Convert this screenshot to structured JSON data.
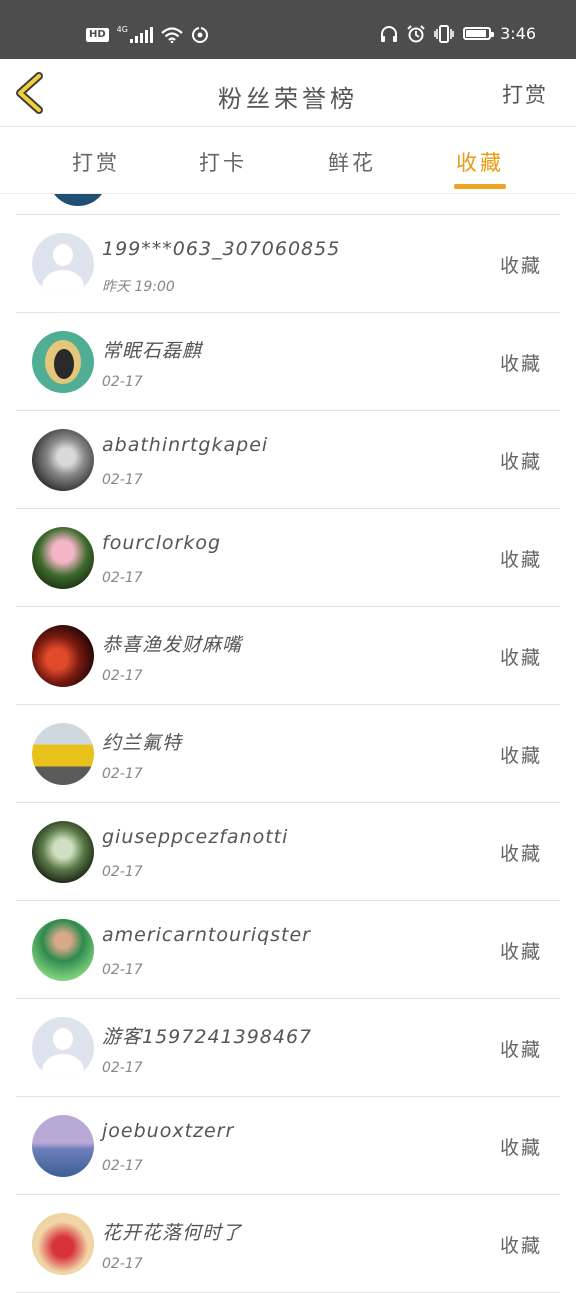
{
  "status_bar": {
    "hd": "HD",
    "network": "4G",
    "time": "3:46",
    "icons": [
      "hd-icon",
      "signal-icon",
      "wifi-icon",
      "hotspot-icon",
      "headphones-icon",
      "alarm-icon",
      "vibrate-icon",
      "battery-icon"
    ]
  },
  "header": {
    "title": "粉丝荣誉榜",
    "action": "打赏",
    "back_icon": "chevron-left-icon",
    "accent_color": "#f0a321"
  },
  "tabs": [
    {
      "label": "打赏",
      "active": false
    },
    {
      "label": "打卡",
      "active": false
    },
    {
      "label": "鲜花",
      "active": false
    },
    {
      "label": "收藏",
      "active": true
    }
  ],
  "fans": [
    {
      "name": "199***063_307060855",
      "time": "昨天 19:00",
      "action": "收藏"
    },
    {
      "name": "常眠石磊麒",
      "time": "02-17",
      "action": "收藏"
    },
    {
      "name": "abathinrtgkapei",
      "time": "02-17",
      "action": "收藏"
    },
    {
      "name": "fourclorkog",
      "time": "02-17",
      "action": "收藏"
    },
    {
      "name": "恭喜渔发财麻嘴",
      "time": "02-17",
      "action": "收藏"
    },
    {
      "name": "约兰氟特",
      "time": "02-17",
      "action": "收藏"
    },
    {
      "name": "giuseppcezfanotti",
      "time": "02-17",
      "action": "收藏"
    },
    {
      "name": "americarntouriqster",
      "time": "02-17",
      "action": "收藏"
    },
    {
      "name": "游客1597241398467",
      "time": "02-17",
      "action": "收藏"
    },
    {
      "name": "joebuoxtzerr",
      "time": "02-17",
      "action": "收藏"
    },
    {
      "name": "花开花落何时了",
      "time": "02-17",
      "action": "收藏"
    }
  ]
}
